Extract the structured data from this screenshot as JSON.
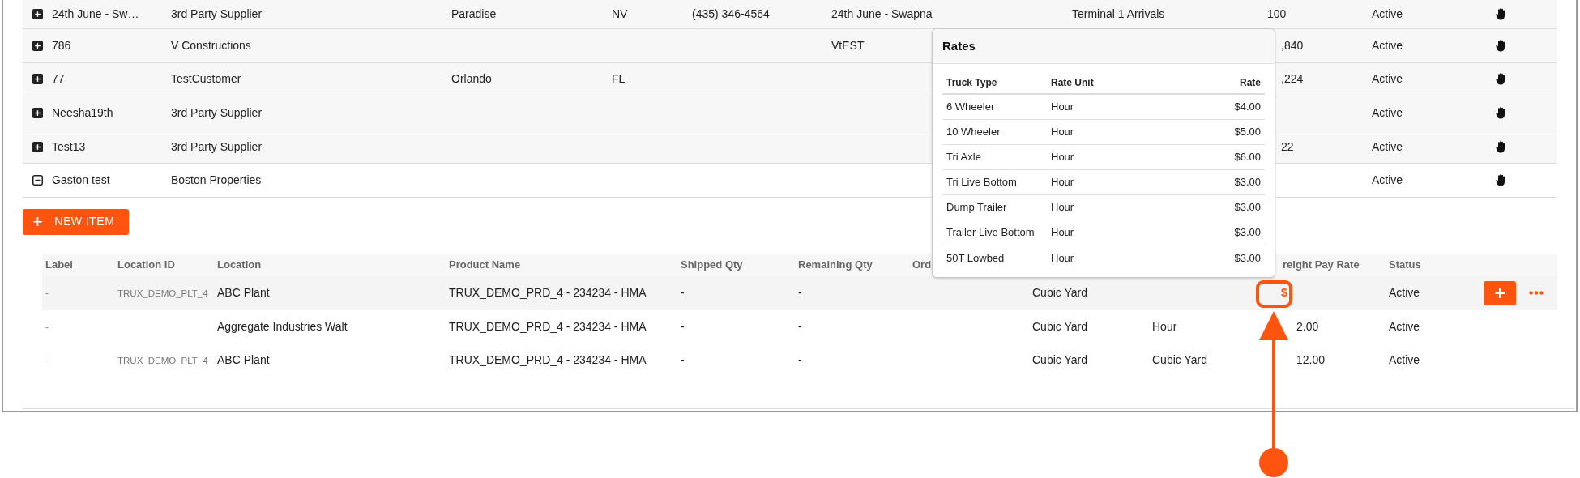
{
  "customers": [
    {
      "expanded": false,
      "cells": {
        "column_1": "24th June - Sw…",
        "column_2": "3rd Party Supplier",
        "column_3": "Paradise",
        "column_4": "NV",
        "column_5": "(435) 346-4564",
        "column_6": "24th June - Swapna",
        "column_7": "Terminal 1 Arrivals",
        "column_8": "100",
        "column_9": "Active"
      }
    },
    {
      "expanded": false,
      "cells": {
        "column_1": "786",
        "column_2": "V Constructions",
        "column_6": "VtEST",
        "column_8": ",840",
        "column_9": "Active"
      }
    },
    {
      "expanded": false,
      "cells": {
        "column_1": "77",
        "column_2": "TestCustomer",
        "column_3": "Orlando",
        "column_4": "FL",
        "column_8": ",224",
        "column_9": "Active"
      }
    },
    {
      "expanded": false,
      "cells": {
        "column_1": "Neesha19th",
        "column_2": "3rd Party Supplier",
        "column_9": "Active"
      }
    },
    {
      "expanded": false,
      "cells": {
        "column_1": "Test13",
        "column_2": "3rd Party Supplier",
        "column_8": "22",
        "column_9": "Active"
      }
    },
    {
      "expanded": true,
      "cells": {
        "column_1": "Gaston test",
        "column_2": "Boston Properties",
        "column_9": "Active"
      }
    }
  ],
  "new_item_button": {
    "icon": "+",
    "label": "NEW ITEM"
  },
  "items_table": {
    "columns": [
      {
        "label": "Label"
      },
      {
        "label": "Location ID"
      },
      {
        "label": "Location"
      },
      {
        "label": "Product Name"
      },
      {
        "label": "Shipped Qty"
      },
      {
        "label": "Remaining Qty"
      },
      {
        "label": "Ord"
      },
      {},
      {},
      {
        "label": "reight Pay Rate"
      },
      {
        "label": "Status"
      }
    ],
    "rows": [
      {
        "selected": true,
        "label": "-",
        "location_id": "TRUX_DEMO_PLT_4",
        "location": "ABC Plant",
        "product": "TRUX_DEMO_PRD_4 - 234234 - HMA",
        "shipped": "-",
        "remaining": "-",
        "unit": "Cubic Yard",
        "rate": {
          "kind": "button",
          "text": "$"
        },
        "status": "Active"
      },
      {
        "selected": false,
        "label": "-",
        "location": "Aggregate Industries Walt",
        "product": "TRUX_DEMO_PRD_4 - 234234 - HMA",
        "shipped": "-",
        "remaining": "-",
        "unit": "Cubic Yard",
        "rate_unit": "Hour",
        "rate": {
          "kind": "text",
          "text": "2.00"
        },
        "status": "Active"
      },
      {
        "selected": false,
        "label": "-",
        "location_id": "TRUX_DEMO_PLT_4",
        "location": "ABC Plant",
        "product": "TRUX_DEMO_PRD_4 - 234234 - HMA",
        "shipped": "-",
        "remaining": "-",
        "unit": "Cubic Yard",
        "rate_unit": "Cubic Yard",
        "rate": {
          "kind": "text",
          "text": "12.00"
        },
        "status": "Active"
      }
    ]
  },
  "rates_popover": {
    "title": "Rates",
    "columns": [
      "Truck Type",
      "Rate Unit",
      "Rate"
    ],
    "rows": [
      {
        "truck_type": "6 Wheeler",
        "rate_unit": "Hour",
        "rate": "$4.00"
      },
      {
        "truck_type": "10 Wheeler",
        "rate_unit": "Hour",
        "rate": "$5.00"
      },
      {
        "truck_type": "Tri Axle",
        "rate_unit": "Hour",
        "rate": "$6.00"
      },
      {
        "truck_type": "Tri Live Bottom",
        "rate_unit": "Hour",
        "rate": "$3.00"
      },
      {
        "truck_type": "Dump Trailer",
        "rate_unit": "Hour",
        "rate": "$3.00"
      },
      {
        "truck_type": "Trailer Live Bottom",
        "rate_unit": "Hour",
        "rate": "$3.00"
      },
      {
        "truck_type": "50T Lowbed",
        "rate_unit": "Hour",
        "rate": "$3.00"
      }
    ]
  }
}
